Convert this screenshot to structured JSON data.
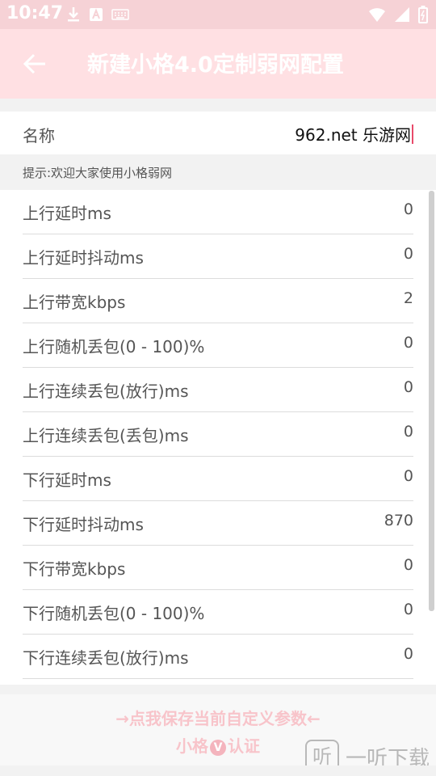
{
  "statusbar": {
    "time": "10:47",
    "icons": [
      "download-icon",
      "a-icon",
      "keyboard-icon",
      "wifi-icon",
      "signal-icon",
      "battery-icon"
    ]
  },
  "appbar": {
    "title": "新建小格4.0定制弱网配置",
    "back_icon": "arrow-left-icon"
  },
  "name_field": {
    "label": "名称",
    "value": "962.net 乐游网"
  },
  "tip": "提示:欢迎大家使用小格弱网",
  "rows": [
    {
      "label": "上行延时ms",
      "value": "0"
    },
    {
      "label": "上行延时抖动ms",
      "value": "0"
    },
    {
      "label": "上行带宽kbps",
      "value": "2"
    },
    {
      "label": "上行随机丢包(0 - 100)%",
      "value": "0"
    },
    {
      "label": "上行连续丢包(放行)ms",
      "value": "0"
    },
    {
      "label": "上行连续丢包(丢包)ms",
      "value": "0"
    },
    {
      "label": "下行延时ms",
      "value": "0"
    },
    {
      "label": "下行延时抖动ms",
      "value": "870"
    },
    {
      "label": "下行带宽kbps",
      "value": "0"
    },
    {
      "label": "下行随机丢包(0 - 100)%",
      "value": "0"
    },
    {
      "label": "下行连续丢包(放行)ms",
      "value": "0"
    }
  ],
  "footer": {
    "save_label": "→点我保存当前自定义参数←",
    "cert_before": "小格",
    "cert_badge": "V",
    "cert_after": "认证"
  },
  "watermark": {
    "icon_char": "听",
    "text": "一听下载"
  },
  "colors": {
    "appbar": "#ffe0e3",
    "statusbar": "#f6d2d6",
    "accent_text": "#f8c4ca",
    "cursor": "#e84a6a"
  }
}
